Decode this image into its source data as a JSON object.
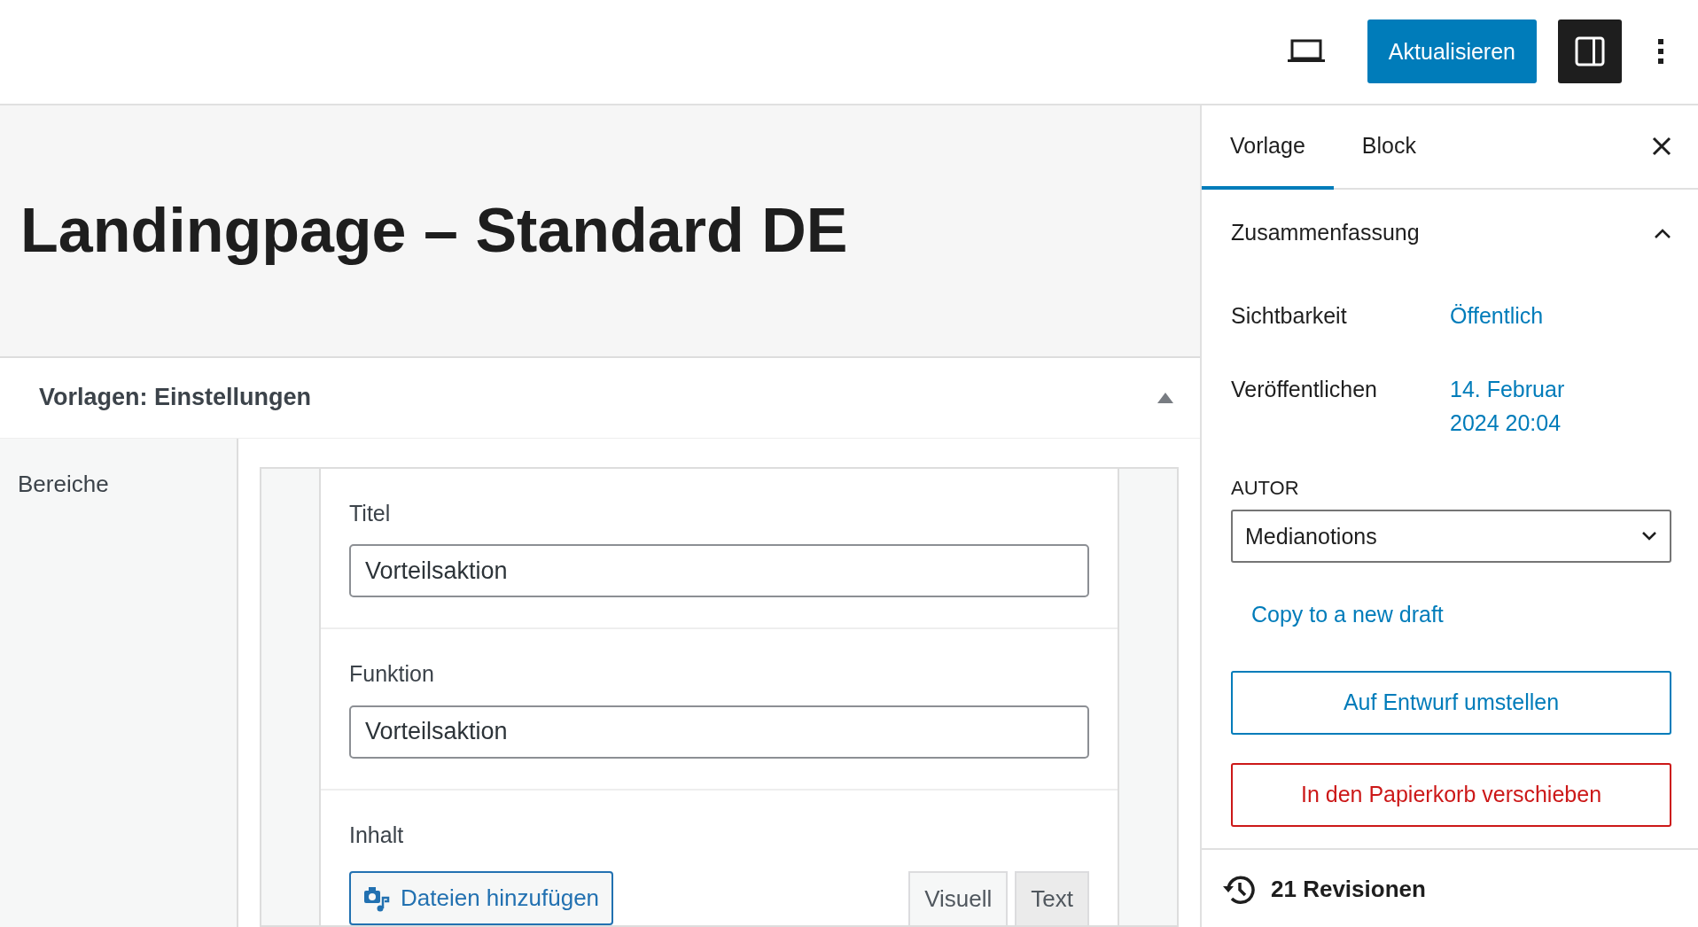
{
  "toolbar": {
    "update_button": "Aktualisieren",
    "sidebar_toggle": {
      "pressed": true
    }
  },
  "title": "Landingpage – Standard DE",
  "metabox": {
    "title": "Vorlagen: Einstellungen",
    "expanded": true,
    "nav_label": "Bereiche",
    "fields": [
      {
        "kind": "text",
        "label": "Titel",
        "value": "Vorteilsaktion"
      },
      {
        "kind": "text",
        "label": "Funktion",
        "value": "Vorteilsaktion"
      },
      {
        "kind": "editor",
        "label": "Inhalt",
        "media_button": "Dateien hinzufügen",
        "tabs": [
          {
            "label": "Visuell",
            "selected": false
          },
          {
            "label": "Text",
            "selected": true
          }
        ]
      }
    ]
  },
  "sidebar": {
    "tabs": [
      {
        "label": "Vorlage",
        "selected": true
      },
      {
        "label": "Block",
        "selected": false
      }
    ],
    "panel": {
      "title": "Zusammenfassung",
      "expanded": true,
      "rows": [
        {
          "label": "Sichtbarkeit",
          "value": "Öffentlich"
        },
        {
          "label": "Veröffentlichen",
          "value": "14. Februar 2024 20:04"
        }
      ],
      "author_label": "AUTOR",
      "author": "Medianotions",
      "copy_link": "Copy to a new draft",
      "draft_button": "Auf Entwurf umstellen",
      "trash_button": "In den Papierkorb verschieben"
    },
    "revisions": "21 Revisionen"
  }
}
